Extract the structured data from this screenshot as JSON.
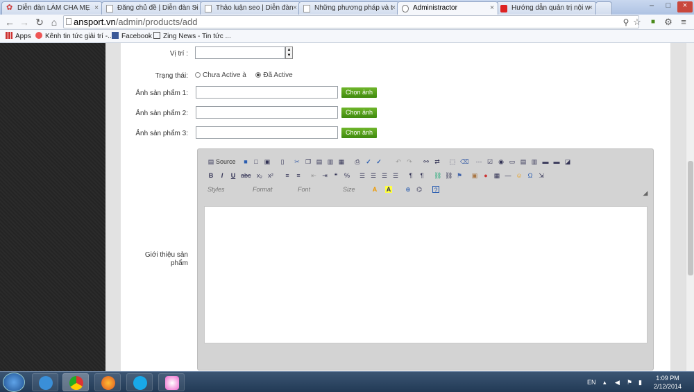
{
  "browser": {
    "tabs": [
      {
        "label": "Diễn đàn LÀM CHA MẸ",
        "active": false
      },
      {
        "label": "Đăng chủ đề | Diễn đàn Si",
        "active": false
      },
      {
        "label": "Thảo luận seo | Diễn đàn",
        "active": false
      },
      {
        "label": "Những phương pháp và t",
        "active": false
      },
      {
        "label": "Administractor",
        "active": true
      },
      {
        "label": "Hướng dẫn quản trị nội w",
        "active": false
      }
    ],
    "tab_close": "×",
    "url_host": "ansport.vn",
    "url_path": "/admin/products/add",
    "bookmarks": [
      {
        "label": "Apps"
      },
      {
        "label": "Kênh tin tức giải trí -..."
      },
      {
        "label": "Facebook"
      },
      {
        "label": "Zing News - Tin tức ..."
      }
    ]
  },
  "form": {
    "position_label": "Vị trí :",
    "status_label": "Trạng thái:",
    "status_options": [
      "Chưa Active à",
      "Đã Active"
    ],
    "status_selected": 1,
    "image1_label": "Ảnh sản phẩm 1:",
    "image2_label": "Ảnh sản phẩm 2:",
    "image3_label": "Ảnh sản phẩm 3:",
    "choose_image_label": "Chọn ảnh",
    "intro_label": "Giới thiệu sản phẩm"
  },
  "editor": {
    "source_label": "Source",
    "styles_label": "Styles",
    "format_label": "Format",
    "font_label": "Font",
    "size_label": "Size"
  },
  "taskbar": {
    "lang": "EN",
    "time": "1:09 PM",
    "date": "2/12/2014"
  }
}
